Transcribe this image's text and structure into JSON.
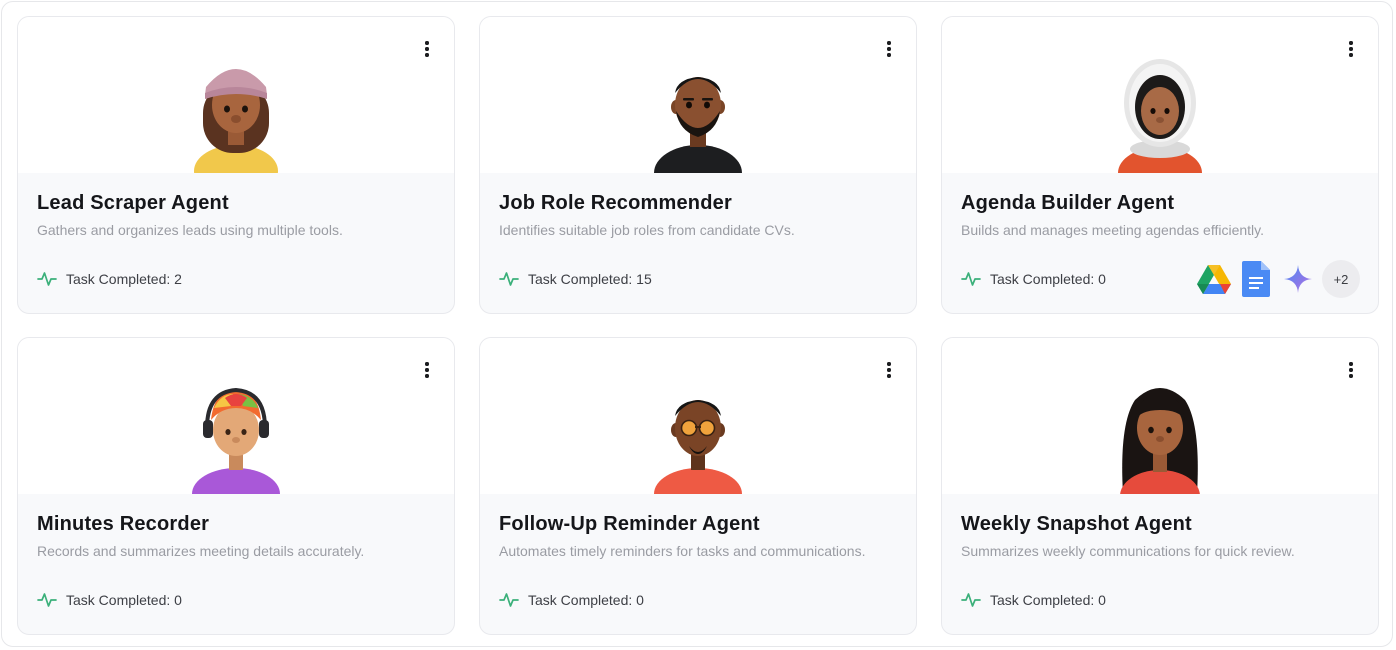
{
  "cards": [
    {
      "title": "Lead Scraper Agent",
      "description": "Gathers and organizes leads using multiple tools.",
      "task_label": "Task Completed:",
      "task_count": "2",
      "avatar": "avatar-beanie-woman",
      "menu_icon": "more-vertical-icon",
      "stat_icon": "activity-icon"
    },
    {
      "title": "Job Role Recommender",
      "description": "Identifies suitable job roles from candidate CVs.",
      "task_label": "Task Completed:",
      "task_count": "15",
      "avatar": "avatar-bearded-man",
      "menu_icon": "more-vertical-icon",
      "stat_icon": "activity-icon"
    },
    {
      "title": "Agenda Builder Agent",
      "description": "Builds and manages meeting agendas efficiently.",
      "task_label": "Task Completed:",
      "task_count": "0",
      "avatar": "avatar-astronaut",
      "menu_icon": "more-vertical-icon",
      "stat_icon": "activity-icon",
      "integrations": [
        "google-drive-icon",
        "google-docs-icon",
        "gemini-icon"
      ],
      "integrations_more": "+2"
    },
    {
      "title": "Minutes Recorder",
      "description": "Records and summarizes meeting details accurately.",
      "task_label": "Task Completed:",
      "task_count": "0",
      "avatar": "avatar-headphones-rainbow-hair",
      "menu_icon": "more-vertical-icon",
      "stat_icon": "activity-icon"
    },
    {
      "title": "Follow-Up Reminder Agent",
      "description": "Automates timely reminders for tasks and communications.",
      "task_label": "Task Completed:",
      "task_count": "0",
      "avatar": "avatar-sunglasses-man",
      "menu_icon": "more-vertical-icon",
      "stat_icon": "activity-icon"
    },
    {
      "title": "Weekly Snapshot Agent",
      "description": "Summarizes weekly communications for quick review.",
      "task_label": "Task Completed:",
      "task_count": "0",
      "avatar": "avatar-long-hair-woman",
      "menu_icon": "more-vertical-icon",
      "stat_icon": "activity-icon"
    }
  ],
  "colors": {
    "activity_green": "#3bb07a",
    "title": "#15161a",
    "description": "#9a9ca3",
    "card_bg": "#f8f9fb"
  }
}
